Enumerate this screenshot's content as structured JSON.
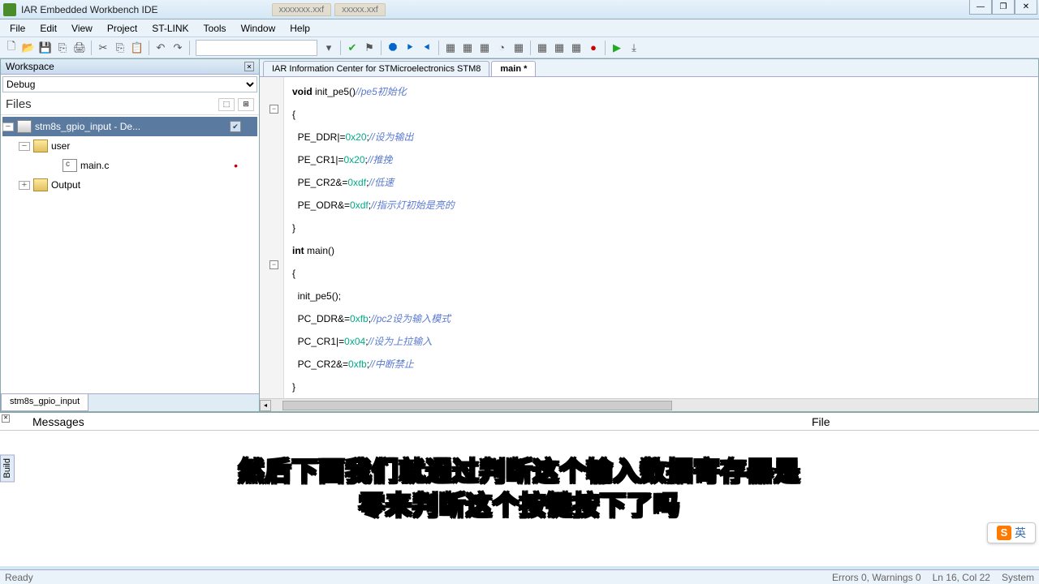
{
  "window": {
    "title": "IAR Embedded Workbench IDE",
    "bg_tab1": "xxxxxxx.xxf",
    "bg_tab2": "xxxxx.xxf"
  },
  "menu": {
    "file": "File",
    "edit": "Edit",
    "view": "View",
    "project": "Project",
    "stlink": "ST-LINK",
    "tools": "Tools",
    "window": "Window",
    "help": "Help"
  },
  "workspace": {
    "title": "Workspace",
    "config": "Debug",
    "files_label": "Files",
    "tree": {
      "root": "stm8s_gpio_input - De...",
      "user": "user",
      "main": "main.c",
      "output": "Output"
    },
    "tab": "stm8s_gpio_input"
  },
  "editor": {
    "tab1": "IAR Information Center for STMicroelectronics STM8",
    "tab2": "main *",
    "code": {
      "l1_kw": "void",
      "l1_rest": " init_pe5()",
      "l1_cm": "//pe5初始化",
      "l2": "{",
      "l3a": "  PE_DDR|=",
      "l3h": "0x20",
      "l3b": ";",
      "l3cm": "//设为输出",
      "l4a": "  PE_CR1|=",
      "l4h": "0x20",
      "l4b": ";",
      "l4cm": "//推挽",
      "l5a": "  PE_CR2&=",
      "l5h": "0xdf",
      "l5b": ";",
      "l5cm": "//低速",
      "l6a": "  PE_ODR&=",
      "l6h": "0xdf",
      "l6b": ";",
      "l6cm": "//指示灯初始是亮的",
      "l7": "}",
      "l8_kw": "int",
      "l8_rest": " main()",
      "l9": "{",
      "l10": "  init_pe5();",
      "l11a": "  PC_DDR&=",
      "l11h": "0xfb",
      "l11b": ";",
      "l11cm": "//pc2设为输入模式",
      "l12a": "  PC_CR1|=",
      "l12h": "0x04",
      "l12b": ";",
      "l12cm": "//设为上拉输入",
      "l13a": "  PC_CR2&=",
      "l13h": "0xfb",
      "l13b": ";",
      "l13cm": "//中断禁止",
      "l14": "}"
    }
  },
  "messages": {
    "col_messages": "Messages",
    "col_file": "File"
  },
  "subtitle": {
    "line1": "然后下面我们就通过判断这个输入数据寄存器是",
    "line2": "零来判断这个按键按下了吗"
  },
  "ime": {
    "s": "S",
    "t": "英"
  },
  "status": {
    "ready": "Ready",
    "errors": "Errors 0, Warnings 0",
    "pos": "Ln 16, Col 22",
    "system": "System"
  },
  "build": "Build"
}
